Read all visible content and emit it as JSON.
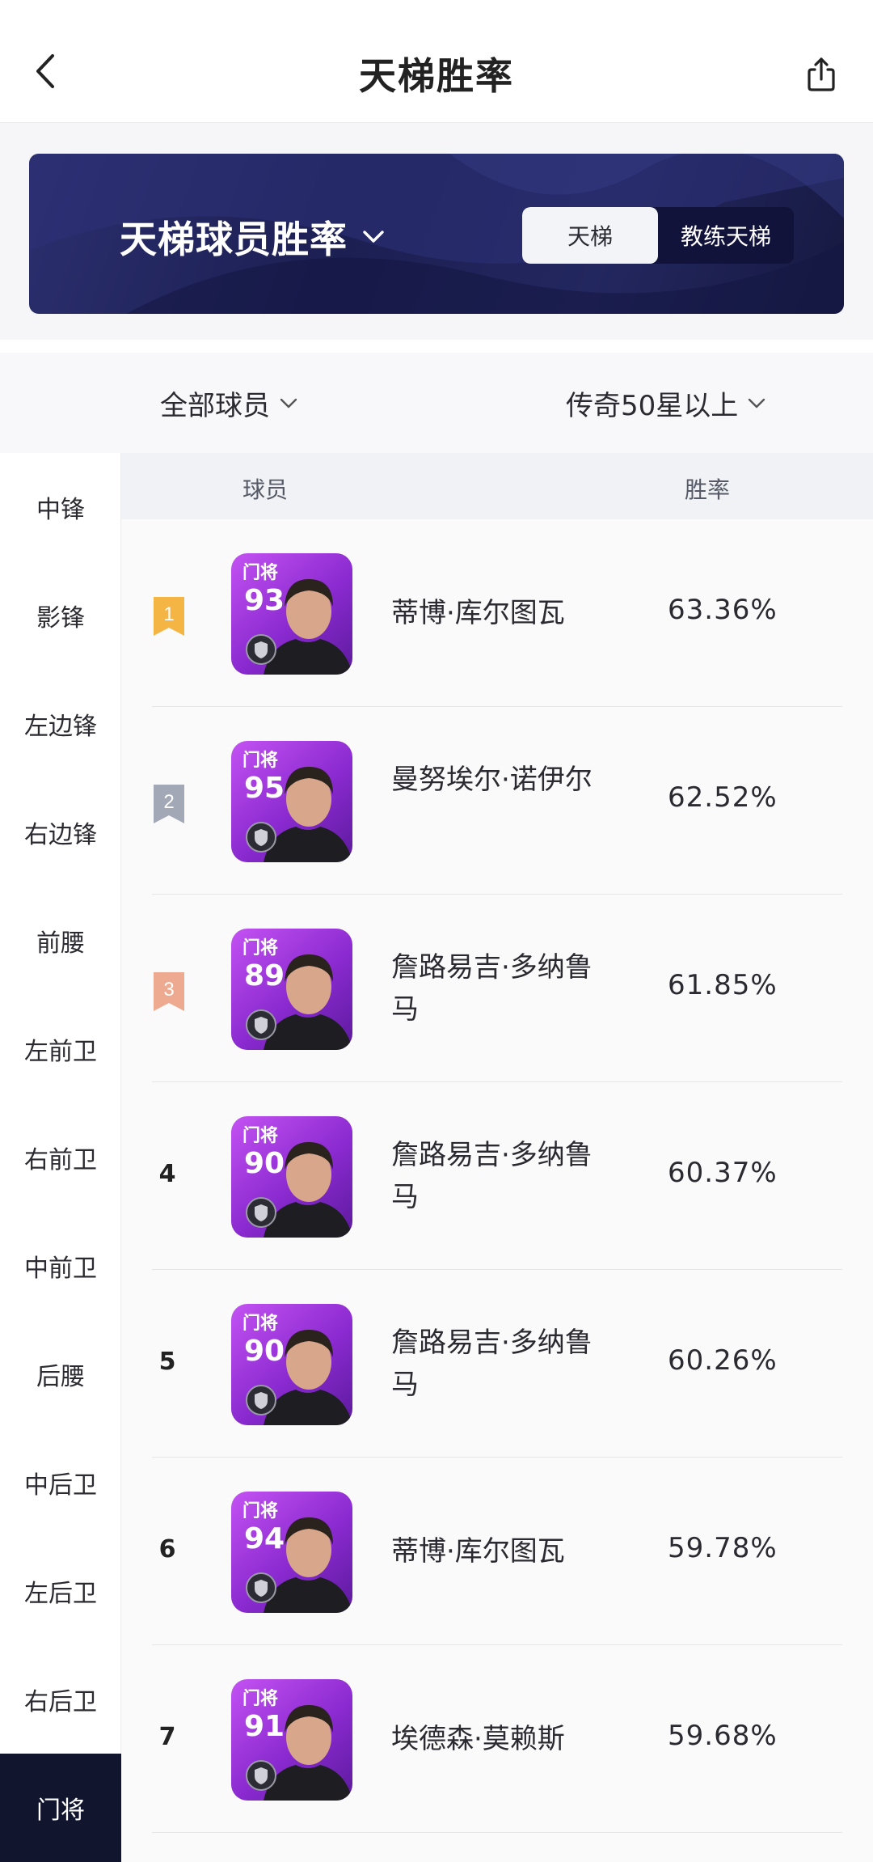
{
  "header": {
    "title": "天梯胜率",
    "back_icon": "chevron-left-icon",
    "share_icon": "share-icon"
  },
  "banner": {
    "title": "天梯球员胜率",
    "segments": [
      {
        "label": "天梯",
        "active": true
      },
      {
        "label": "教练天梯",
        "active": false
      }
    ]
  },
  "filters": {
    "player_filter": "全部球员",
    "level_filter": "传奇50星以上"
  },
  "sidebar": {
    "items": [
      {
        "label": "中锋"
      },
      {
        "label": "影锋"
      },
      {
        "label": "左边锋"
      },
      {
        "label": "右边锋"
      },
      {
        "label": "前腰"
      },
      {
        "label": "左前卫"
      },
      {
        "label": "右前卫"
      },
      {
        "label": "中前卫"
      },
      {
        "label": "后腰"
      },
      {
        "label": "中后卫"
      },
      {
        "label": "左后卫"
      },
      {
        "label": "右后卫"
      },
      {
        "label": "门将"
      }
    ],
    "active_item": "门将"
  },
  "table": {
    "col_player": "球员",
    "col_rate": "胜率",
    "rows": [
      {
        "rank": "1",
        "position": "门将",
        "rating": "93",
        "name": "蒂博·库尔图瓦",
        "win_rate": "63.36%",
        "badge_color": "#f5b545"
      },
      {
        "rank": "2",
        "position": "门将",
        "rating": "95",
        "name": "曼努埃尔·诺伊尔",
        "win_rate": "62.52%",
        "badge_color": "#a3a8b6"
      },
      {
        "rank": "3",
        "position": "门将",
        "rating": "89",
        "name": "詹路易吉·多纳鲁马",
        "win_rate": "61.85%",
        "badge_color": "#eeaa90"
      },
      {
        "rank": "4",
        "position": "门将",
        "rating": "90",
        "name": "詹路易吉·多纳鲁马",
        "win_rate": "60.37%"
      },
      {
        "rank": "5",
        "position": "门将",
        "rating": "90",
        "name": "詹路易吉·多纳鲁马",
        "win_rate": "60.26%"
      },
      {
        "rank": "6",
        "position": "门将",
        "rating": "94",
        "name": "蒂博·库尔图瓦",
        "win_rate": "59.78%"
      },
      {
        "rank": "7",
        "position": "门将",
        "rating": "91",
        "name": "埃德森·莫赖斯",
        "win_rate": "59.68%"
      }
    ]
  },
  "colors": {
    "active_sidebar": "#12152e",
    "card_purple": "#9b34dc",
    "banner_navy": "#1c1f52"
  }
}
